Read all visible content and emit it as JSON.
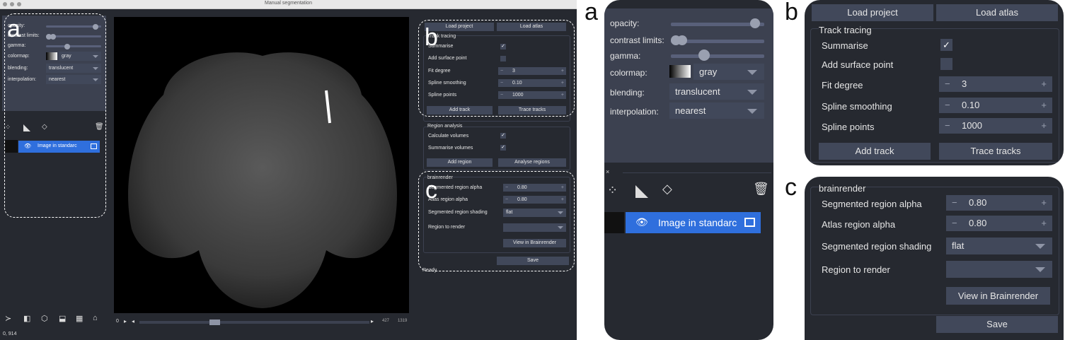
{
  "window": {
    "title": "Manual segmentation"
  },
  "layer_controls": {
    "opacity_label": "opacity:",
    "contrast_label": "contrast limits:",
    "gamma_label": "gamma:",
    "colormap_label": "colormap:",
    "colormap_value": "gray",
    "blending_label": "blending:",
    "blending_value": "translucent",
    "interpolation_label": "interpolation:",
    "interpolation_value": "nearest",
    "opacity_value": 0.93,
    "gamma_value": 0.35
  },
  "layer_list": {
    "layer_name": "Image in standarc"
  },
  "track_tracing": {
    "load_project": "Load project",
    "load_atlas": "Load atlas",
    "section_title": "Track tracing",
    "summarise_label": "Summarise",
    "add_surface_label": "Add surface point",
    "fit_degree_label": "Fit degree",
    "fit_degree_value": "3",
    "spline_smoothing_label": "Spline smoothing",
    "spline_smoothing_value": "0.10",
    "spline_points_label": "Spline points",
    "spline_points_value": "1000",
    "add_track": "Add track",
    "trace_tracks": "Trace tracks"
  },
  "region_analysis": {
    "section_title": "Region analysis",
    "calc_volumes_label": "Calculate volumes",
    "summarise_volumes_label": "Summarise volumes",
    "add_region": "Add region",
    "analyse_regions": "Analyse regions"
  },
  "brainrender": {
    "section_title": "brainrender",
    "seg_alpha_label": "Segmented region alpha",
    "seg_alpha_value": "0.80",
    "atlas_alpha_label": "Atlas region alpha",
    "atlas_alpha_value": "0.80",
    "shading_label": "Segmented region shading",
    "shading_value": "flat",
    "region_label": "Region to render",
    "view_button": "View in Brainrender",
    "save_button": "Save"
  },
  "status": {
    "ready": "Ready",
    "coords": "0, 914",
    "slice_start": "0",
    "slice_current": "427",
    "slice_total": "1319"
  },
  "panel_letters": {
    "a": "a",
    "b": "b",
    "c": "c"
  }
}
